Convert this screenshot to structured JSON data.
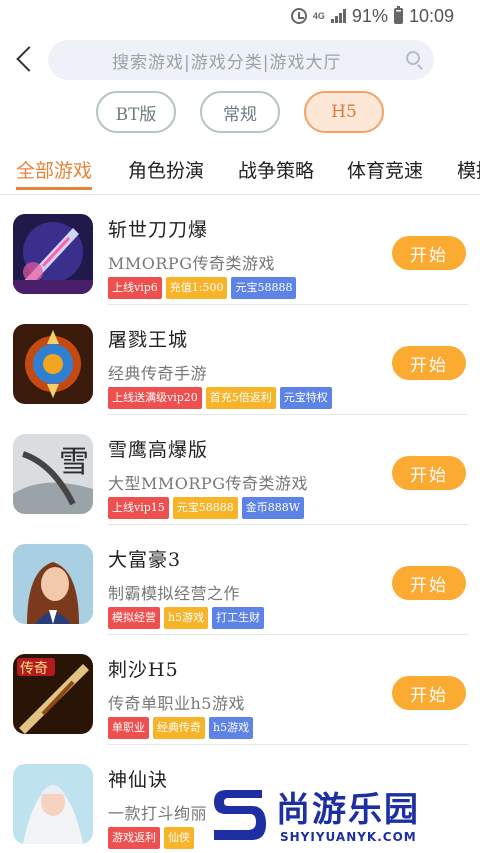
{
  "status_bar": {
    "network": "4G",
    "battery": "91%",
    "time": "10:09"
  },
  "search": {
    "placeholder": "搜索游戏|游戏分类|游戏大厅"
  },
  "filters": [
    {
      "label": "BT版",
      "active": false
    },
    {
      "label": "常规",
      "active": false
    },
    {
      "label": "H5",
      "active": true
    }
  ],
  "tabs": [
    {
      "label": "全部游戏",
      "active": true
    },
    {
      "label": "角色扮演",
      "active": false
    },
    {
      "label": "战争策略",
      "active": false
    },
    {
      "label": "体育竞速",
      "active": false
    },
    {
      "label": "模拟",
      "active": false
    }
  ],
  "games": [
    {
      "title": "斩世刀刀爆",
      "desc": "MMORPG传奇类游戏",
      "tags": [
        {
          "text": "上线vip6",
          "color": "red"
        },
        {
          "text": "充值1:500",
          "color": "yellow"
        },
        {
          "text": "元宝58888",
          "color": "blue"
        }
      ],
      "button": "开始"
    },
    {
      "title": "屠戮王城",
      "desc": "经典传奇手游",
      "tags": [
        {
          "text": "上线送满级vip20",
          "color": "red"
        },
        {
          "text": "首充5倍返利",
          "color": "yellow"
        },
        {
          "text": "元宝特权",
          "color": "blue"
        }
      ],
      "button": "开始"
    },
    {
      "title": "雪鹰高爆版",
      "desc": "大型MMORPG传奇类游戏",
      "tags": [
        {
          "text": "上线vip15",
          "color": "red"
        },
        {
          "text": "元宝58888",
          "color": "yellow"
        },
        {
          "text": "金币888W",
          "color": "blue"
        }
      ],
      "button": "开始"
    },
    {
      "title": "大富豪3",
      "desc": "制霸模拟经营之作",
      "tags": [
        {
          "text": "模拟经营",
          "color": "red"
        },
        {
          "text": "h5游戏",
          "color": "yellow"
        },
        {
          "text": "打工生财",
          "color": "blue"
        }
      ],
      "button": "开始"
    },
    {
      "title": "刺沙H5",
      "desc": "传奇单职业h5游戏",
      "tags": [
        {
          "text": "单职业",
          "color": "red"
        },
        {
          "text": "经典传奇",
          "color": "yellow"
        },
        {
          "text": "h5游戏",
          "color": "blue"
        }
      ],
      "button": "开始"
    },
    {
      "title": "神仙诀",
      "desc": "一款打斗绚丽",
      "tags": [
        {
          "text": "游戏返利",
          "color": "red"
        },
        {
          "text": "仙侠",
          "color": "yellow"
        }
      ],
      "button": ""
    }
  ],
  "thumb_text": {
    "game3": "雪",
    "game5": "传奇"
  },
  "watermark": {
    "brand": "尚游乐园",
    "url": "SHYIYUANYK.COM"
  }
}
